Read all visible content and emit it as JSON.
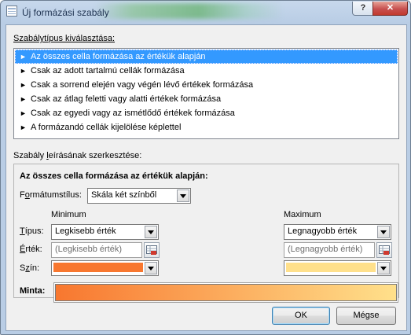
{
  "window": {
    "title": "Új formázási szabály",
    "help_glyph": "?",
    "close_glyph": "✕"
  },
  "rule_type": {
    "label": "Szabálytípus kiválasztása:",
    "items": [
      "Az összes cella formázása az értékük alapján",
      "Csak az adott tartalmú cellák formázása",
      "Csak a sorrend elején vagy végén lévő értékek formázása",
      "Csak az átlag feletti vagy alatti értékek formázása",
      "Csak az egyedi vagy az ismétlődő értékek formázása",
      "A formázandó cellák kijelölése képlettel"
    ],
    "selected_index": 0,
    "arrow": "►"
  },
  "description": {
    "label": "Szabály leírásának szerkesztése:",
    "heading": "Az összes cella formázása az értékük alapján:",
    "format_style_label": "Formátumstílus:",
    "format_style_value": "Skála két színből",
    "minimum_header": "Minimum",
    "maximum_header": "Maximum",
    "type_label": "Típus:",
    "value_label": "Érték:",
    "color_label": "Szín:",
    "min_type": "Legkisebb érték",
    "max_type": "Legnagyobb érték",
    "min_value_placeholder": "(Legkisebb érték)",
    "max_value_placeholder": "(Legnagyobb érték)",
    "min_color": "#f8772f",
    "max_color": "#ffe08b",
    "preview_label": "Minta:"
  },
  "buttons": {
    "ok": "OK",
    "cancel": "Mégse"
  }
}
